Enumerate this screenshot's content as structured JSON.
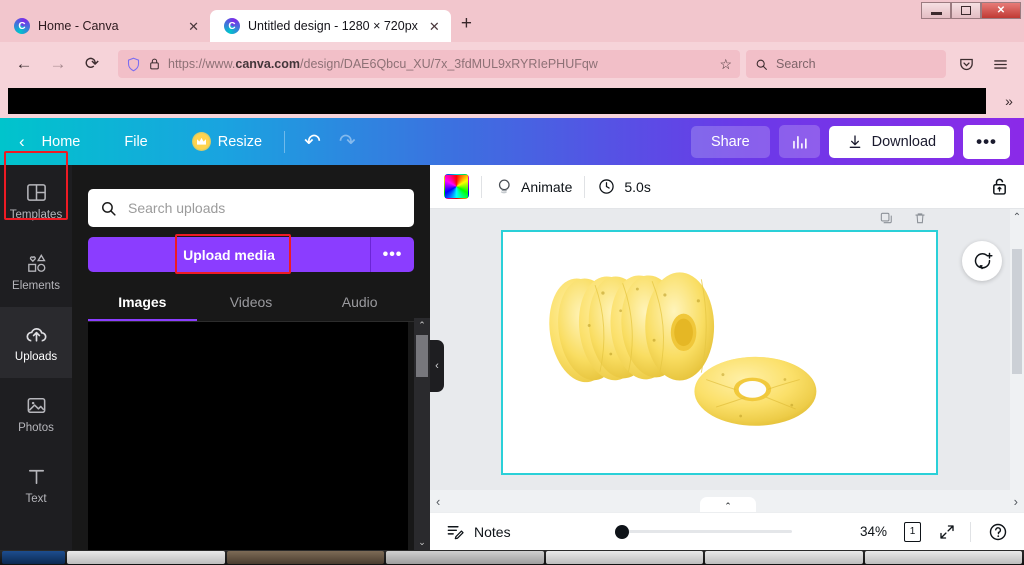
{
  "browser": {
    "window_controls": {
      "minimize": "minimize-icon",
      "maximize": "maximize-icon",
      "close": "✕"
    },
    "tabs": [
      {
        "title": "Home - Canva",
        "favicon": "canva-icon",
        "close": "✕",
        "active": false
      },
      {
        "title": "Untitled design - 1280 × 720px",
        "favicon": "canva-icon",
        "close": "✕",
        "active": true
      }
    ],
    "new_tab_label": "+",
    "nav": {
      "back": "←",
      "forward": "→",
      "reload": "⟳"
    },
    "url_prefix": "https://www.",
    "url_domain": "canva.com",
    "url_suffix": "/design/DAE6Qbcu_XU/7x_3fdMUL9xRYRIePHUFqw",
    "bookmark_star": "☆",
    "search_placeholder": "Search",
    "pocket_icon": "pocket-icon",
    "menu_icon": "hamburger-menu-icon",
    "bookmarks_overflow": "»"
  },
  "canva_header": {
    "back_arrow": "‹",
    "home_label": "Home",
    "file_label": "File",
    "resize_label": "Resize",
    "crown_icon": "crown-icon",
    "undo_icon": "↶",
    "redo_icon": "↷",
    "share_label": "Share",
    "stats_icon": "bar-chart-icon",
    "download_label": "Download",
    "download_icon": "download-arrow-icon",
    "more_label": "•••"
  },
  "rail": {
    "items": [
      {
        "label": "Templates",
        "icon": "templates-icon",
        "active": false
      },
      {
        "label": "Elements",
        "icon": "elements-icon",
        "active": false
      },
      {
        "label": "Uploads",
        "icon": "cloud-upload-icon",
        "active": true
      },
      {
        "label": "Photos",
        "icon": "photos-icon",
        "active": false
      },
      {
        "label": "Text",
        "icon": "text-icon",
        "active": false
      }
    ]
  },
  "panel": {
    "search_placeholder": "Search uploads",
    "search_icon": "search-icon",
    "upload_label": "Upload media",
    "upload_more": "•••",
    "tabs": [
      {
        "label": "Images",
        "active": true
      },
      {
        "label": "Videos",
        "active": false
      },
      {
        "label": "Audio",
        "active": false
      }
    ],
    "collapse_icon": "‹"
  },
  "canvas_toolbar": {
    "color_swatch": "color-picker-icon",
    "animate_label": "Animate",
    "animate_icon": "animate-icon",
    "duration_label": "5.0s",
    "clock_icon": "clock-icon",
    "lock_icon": "unlock-icon"
  },
  "canvas": {
    "page_image": "pineapple-slices-photo",
    "selection_color": "#2ad0d8",
    "comment_icon": "add-comment-icon",
    "scroll_up": "⌃",
    "scroll_down": "⌄",
    "scroll_left": "‹",
    "scroll_right": "›",
    "panel_collapse": "⌃"
  },
  "statusbar": {
    "notes_label": "Notes",
    "notes_icon": "notes-icon",
    "zoom_percent": "34%",
    "page_number": "1",
    "pages_icon": "pages-icon",
    "fullscreen_icon": "expand-icon",
    "help_icon": "help-icon"
  }
}
